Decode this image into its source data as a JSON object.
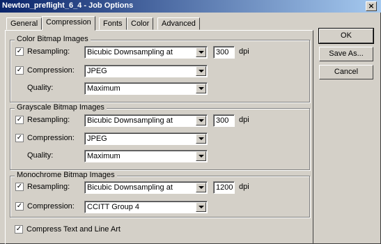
{
  "window": {
    "title": "Newton_preflight_6_4 - Job Options",
    "close_glyph": "×"
  },
  "tabs": [
    {
      "label": "General",
      "active": false
    },
    {
      "label": "Compression",
      "active": true
    },
    {
      "label": "Fonts",
      "active": false
    },
    {
      "label": "Color",
      "active": false
    },
    {
      "label": "Advanced",
      "active": false
    }
  ],
  "check_glyph": "✓",
  "color": {
    "legend": "Color Bitmap Images",
    "resampling": {
      "label": "Resampling:",
      "checked": true,
      "method": "Bicubic Downsampling at",
      "dpi": "300",
      "unit": "dpi"
    },
    "compression": {
      "label": "Compression:",
      "checked": true,
      "value": "JPEG"
    },
    "quality": {
      "label": "Quality:",
      "value": "Maximum"
    }
  },
  "grayscale": {
    "legend": "Grayscale Bitmap Images",
    "resampling": {
      "label": "Resampling:",
      "checked": true,
      "method": "Bicubic Downsampling at",
      "dpi": "300",
      "unit": "dpi"
    },
    "compression": {
      "label": "Compression:",
      "checked": true,
      "value": "JPEG"
    },
    "quality": {
      "label": "Quality:",
      "value": "Maximum"
    }
  },
  "monochrome": {
    "legend": "Monochrome Bitmap Images",
    "resampling": {
      "label": "Resampling:",
      "checked": true,
      "method": "Bicubic Downsampling at",
      "dpi": "1200",
      "unit": "dpi"
    },
    "compression": {
      "label": "Compression:",
      "checked": true,
      "value": "CCITT Group 4"
    }
  },
  "compress_text": {
    "label": "Compress Text and Line Art",
    "checked": true
  },
  "buttons": {
    "ok": "OK",
    "save_as": "Save As...",
    "cancel": "Cancel"
  },
  "colors": {
    "face": "#d4d0c8",
    "title_start": "#0a246a",
    "title_end": "#a6caf0"
  }
}
